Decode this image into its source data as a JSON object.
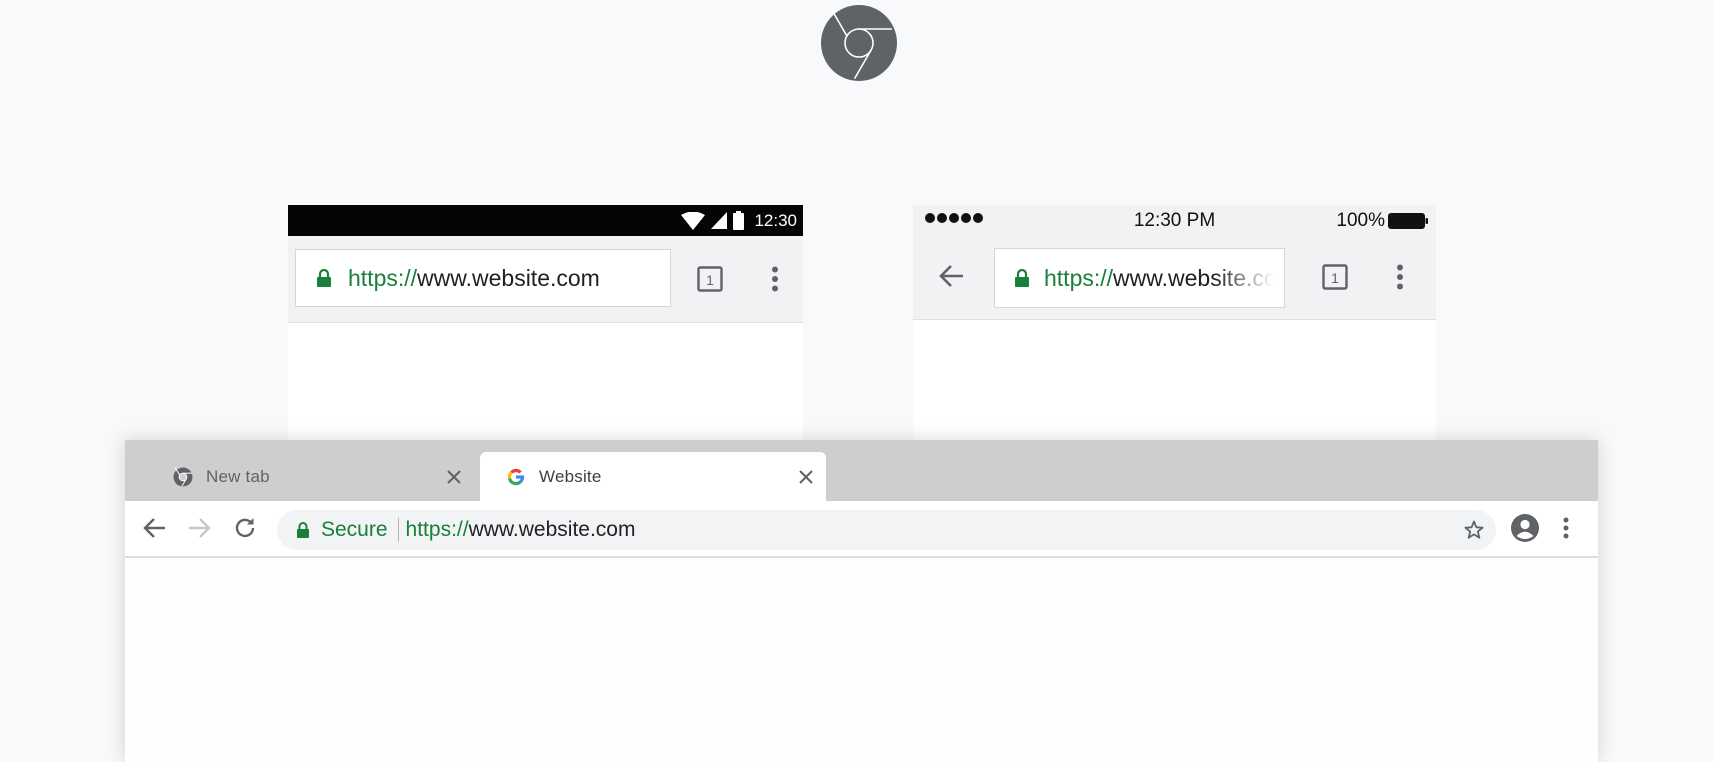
{
  "colors": {
    "secure_green": "#188038",
    "logo_gray": "#5f6368",
    "tabstrip_gray": "#cecece",
    "page_bg": "#f8f9fb"
  },
  "logo": {
    "icon": "chrome-logo-icon"
  },
  "android": {
    "status": {
      "time": "12:30",
      "icons": [
        "wifi-icon",
        "signal-icon",
        "battery-icon"
      ]
    },
    "url": {
      "scheme": "https://",
      "host": "www.website.com"
    },
    "tab_count": "1"
  },
  "ios": {
    "status": {
      "time": "12:30 PM",
      "battery": "100%"
    },
    "url": {
      "scheme": "https://",
      "host": "www.website.com"
    },
    "tab_count": "1"
  },
  "desktop": {
    "tabs": [
      {
        "title": "New tab",
        "icon": "chrome-favicon-icon",
        "active": false
      },
      {
        "title": "Website",
        "icon": "google-favicon-icon",
        "active": true
      }
    ],
    "security_label": "Secure",
    "url": {
      "scheme": "https://",
      "host": "www.website.com"
    }
  }
}
